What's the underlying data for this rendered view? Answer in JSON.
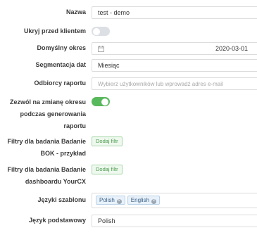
{
  "form": {
    "name_label": "Nazwa",
    "name_value": "test - demo",
    "hide_label": "Ukryj przed klientem",
    "hide_enabled": false,
    "period_label": "Domyślny okres",
    "period_value": "2020-03-01",
    "segmentation_label": "Segmentacja dat",
    "segmentation_value": "Miesiąc",
    "recipients_label": "Odbiorcy raportu",
    "recipients_placeholder": "Wybierz użytkowników lub wprowadź adres e-mail",
    "allow_change_label_1": "Zezwól na zmianę okresu",
    "allow_change_label_2": "podczas generowania",
    "allow_change_label_3": "raportu",
    "allow_change_enabled": true,
    "filters1_label_1": "Filtry dla badania Badanie",
    "filters1_label_2": "BOK - przykład",
    "filters1_button": "Dodaj filtr",
    "filters2_label_1": "Filtry dla badania Badanie",
    "filters2_label_2": "dashboardu YourCX",
    "filters2_button": "Dodaj filtr",
    "languages_label": "Języki szablonu",
    "languages": [
      "Polish",
      "English"
    ],
    "base_language_label": "Język podstawowy",
    "base_language_value": "Polish"
  },
  "colors": {
    "toggle_on": "#58b85c",
    "toggle_off": "#dcdfe3",
    "add_filter_text": "#4a9a4c",
    "tag_bg": "#e8f1fa"
  }
}
